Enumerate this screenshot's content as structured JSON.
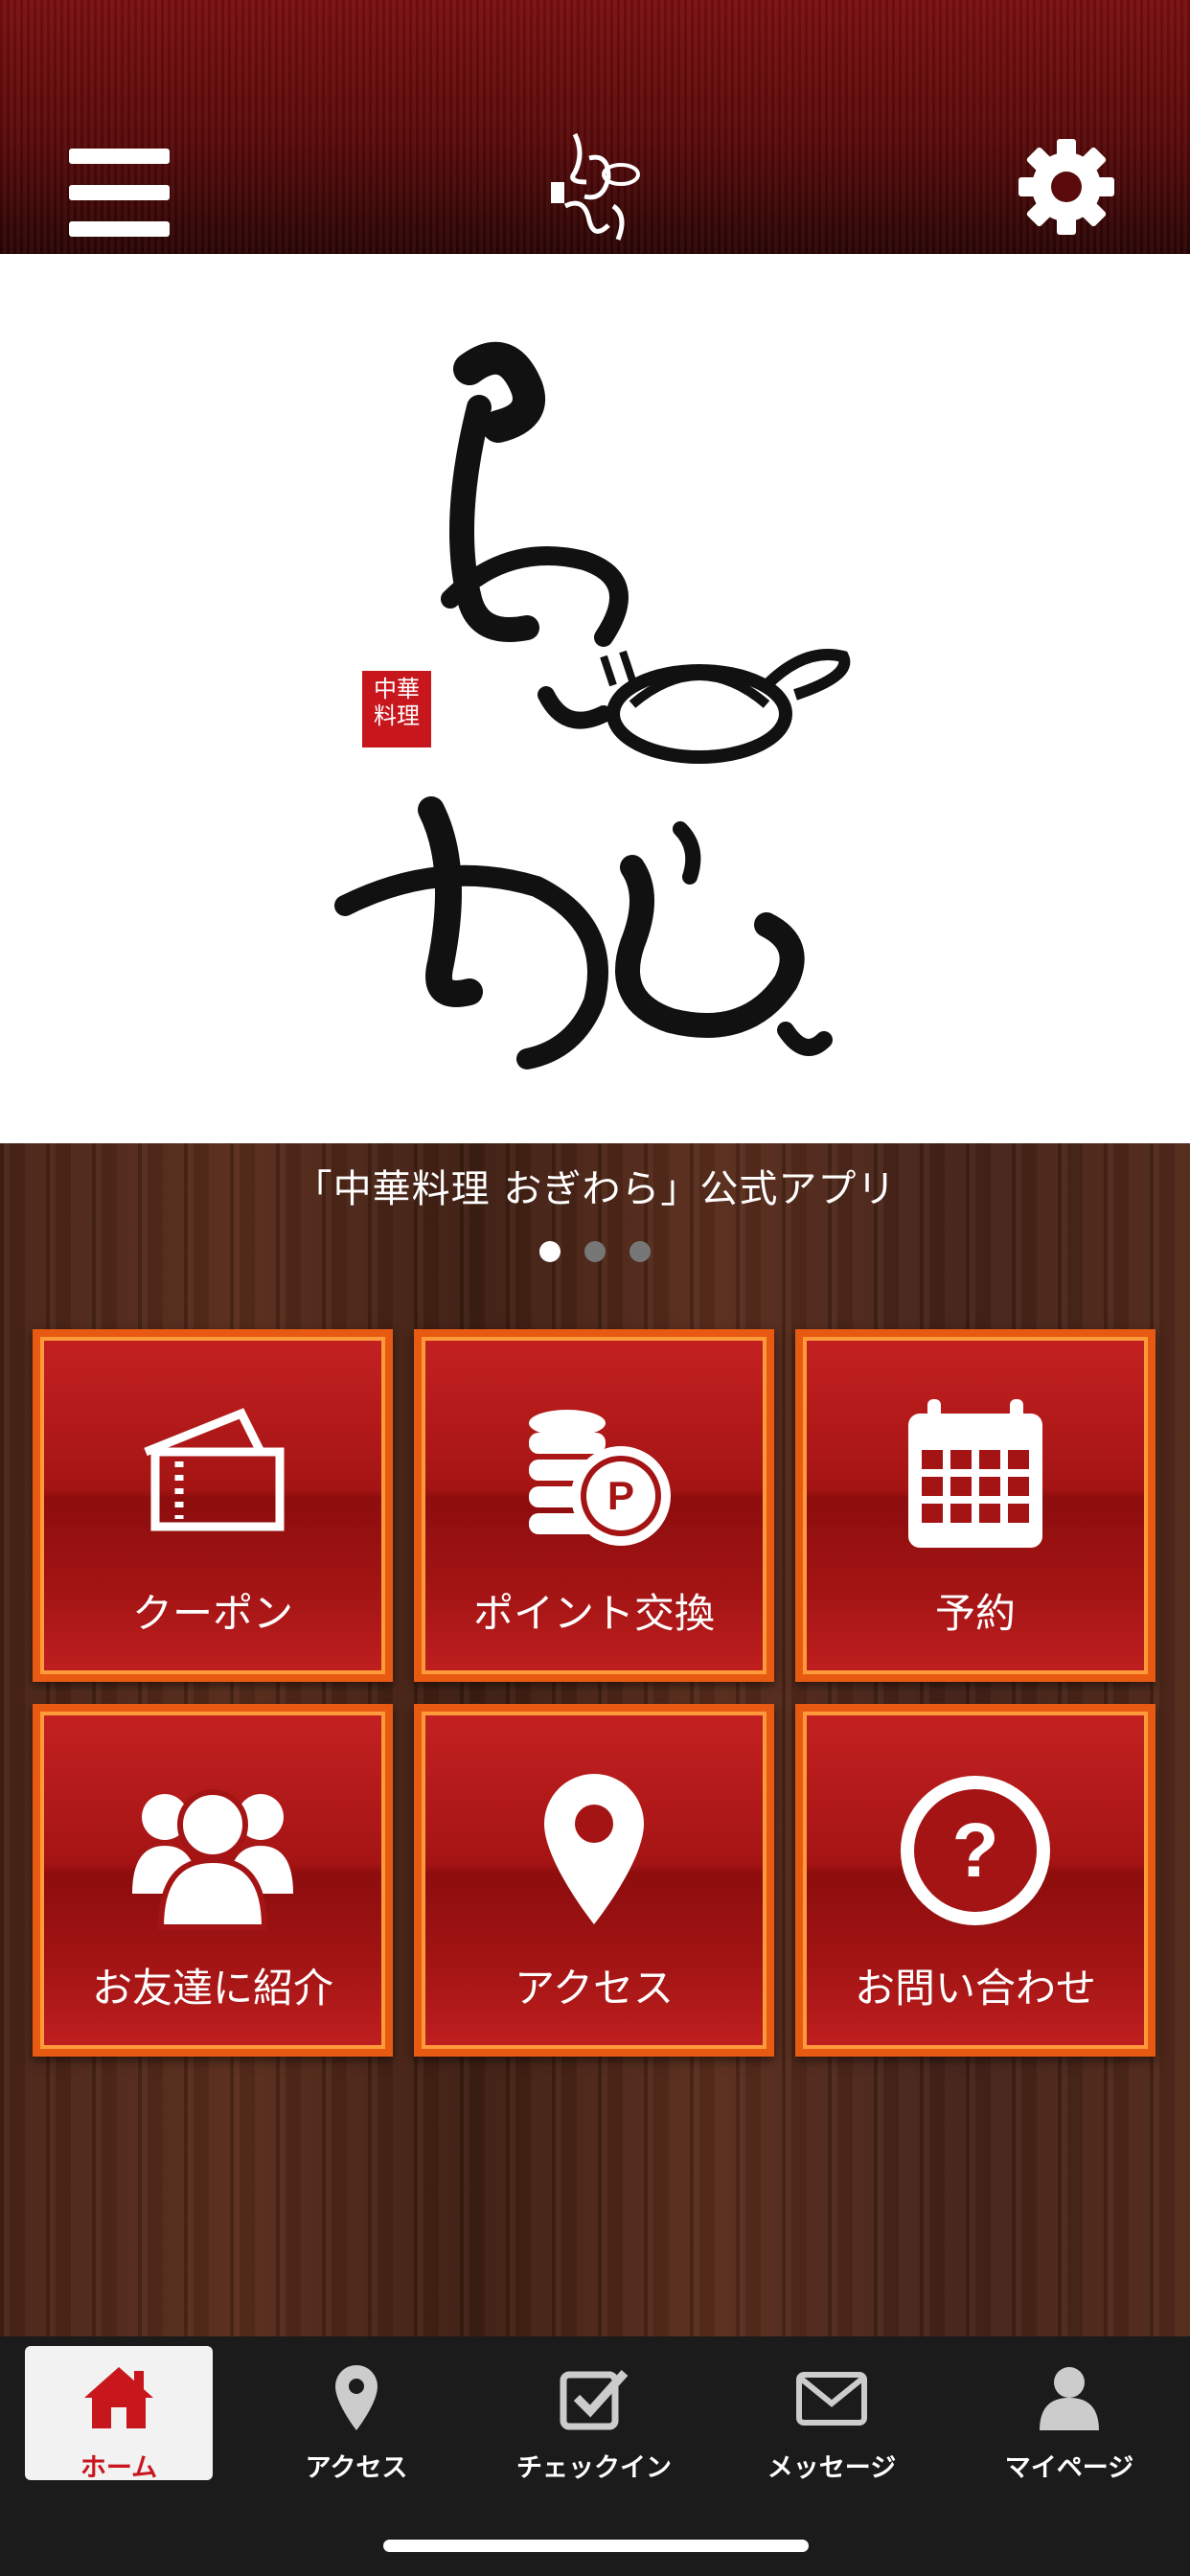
{
  "header": {
    "menu_icon": "hamburger-menu-icon",
    "logo": "ogiwara-logo",
    "settings_icon": "gear-icon"
  },
  "hero": {
    "logo": "ogiwara-calligraphy-logo",
    "seal_text": "中華料理"
  },
  "caption": "「中華料理 おぎわら」公式アプリ",
  "carousel": {
    "count": 3,
    "active_index": 0
  },
  "tiles": [
    {
      "label": "クーポン",
      "icon": "ticket-icon"
    },
    {
      "label": "ポイント交換",
      "icon": "coins-points-icon"
    },
    {
      "label": "予約",
      "icon": "calendar-icon"
    },
    {
      "label": "お友達に紹介",
      "icon": "group-users-icon"
    },
    {
      "label": "アクセス",
      "icon": "map-pin-icon"
    },
    {
      "label": "お問い合わせ",
      "icon": "question-circle-icon"
    }
  ],
  "tabbar": {
    "items": [
      {
        "label": "ホーム",
        "icon": "home-icon",
        "active": true
      },
      {
        "label": "アクセス",
        "icon": "map-pin-icon",
        "active": false
      },
      {
        "label": "チェックイン",
        "icon": "checkin-icon",
        "active": false
      },
      {
        "label": "メッセージ",
        "icon": "envelope-icon",
        "active": false
      },
      {
        "label": "マイページ",
        "icon": "user-icon",
        "active": false
      }
    ]
  },
  "colors": {
    "accent_red": "#c8161d",
    "tile_border": "#e85a12",
    "tab_bar": "#1b1b1b"
  }
}
